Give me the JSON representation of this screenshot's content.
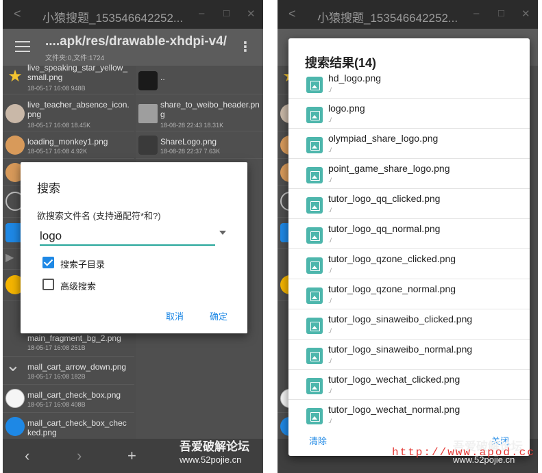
{
  "left": {
    "title": "小猿搜题_153546642252...",
    "path": "....apk/res/drawable-xhdpi-v4/",
    "summary": "文件夹:0,文件:1724",
    "files_left": [
      {
        "name": "live_speaking_star_yellow_small.png",
        "meta": "18-05-17 16:08  948B"
      },
      {
        "name": "live_teacher_absence_icon.png",
        "meta": "18-05-17 16:08  18.45K"
      },
      {
        "name": "loading_monkey1.png",
        "meta": "18-05-17 16:08  4.92K"
      },
      {
        "name": "main_fragment_bg_2.png",
        "meta": "18-05-17 16:08  251B"
      },
      {
        "name": "mall_cart_arrow_down.png",
        "meta": "18-05-17 16:08  182B"
      },
      {
        "name": "mall_cart_check_box.png",
        "meta": "18-05-17 16:08  408B"
      },
      {
        "name": "mall_cart_check_box_checked.png",
        "meta": ""
      }
    ],
    "files_right": [
      {
        "name": "..",
        "meta": ""
      },
      {
        "name": "share_to_weibo_header.png",
        "meta": "18-08-28 22:43  18.31K"
      },
      {
        "name": "ShareLogo.png",
        "meta": "18-08-28 22:37  7.63K"
      }
    ],
    "nav": {
      "back": "‹",
      "forward": "›",
      "add": "+"
    },
    "dialog": {
      "title": "搜索",
      "label": "欲搜索文件名 (支持通配符*和?)",
      "value": "logo",
      "opt_subdir": "搜索子目录",
      "opt_advanced": "高级搜索",
      "cancel": "取消",
      "ok": "确定"
    }
  },
  "right": {
    "title": "小猿搜题_153546642252...",
    "results_title": "搜索结果(14)",
    "results": [
      {
        "name": "hd_logo.png",
        "path": "./"
      },
      {
        "name": "logo.png",
        "path": "./"
      },
      {
        "name": "olympiad_share_logo.png",
        "path": "./"
      },
      {
        "name": "point_game_share_logo.png",
        "path": "./"
      },
      {
        "name": "tutor_logo_qq_clicked.png",
        "path": "./"
      },
      {
        "name": "tutor_logo_qq_normal.png",
        "path": "./"
      },
      {
        "name": "tutor_logo_qzone_clicked.png",
        "path": "./"
      },
      {
        "name": "tutor_logo_qzone_normal.png",
        "path": "./"
      },
      {
        "name": "tutor_logo_sinaweibo_clicked.png",
        "path": "./"
      },
      {
        "name": "tutor_logo_sinaweibo_normal.png",
        "path": "./"
      },
      {
        "name": "tutor_logo_wechat_clicked.png",
        "path": "./"
      },
      {
        "name": "tutor_logo_wechat_normal.png",
        "path": "./"
      }
    ],
    "clear": "清除",
    "close": "关闭"
  },
  "watermark": {
    "left_title": "吾爱破解论坛",
    "left_url": "www.52pojie.cn",
    "right_title": "吾爱破解论坛",
    "right_url": "www.52pojie.cn",
    "site_url": "http://www.apod.cc"
  },
  "colors": {
    "accent": "#1e88e5",
    "teal": "#26a69a",
    "icon_teal": "#4db6ac",
    "url_red": "#e53935"
  },
  "icons": {
    "menu": "menu-icon",
    "more": "more-vert-icon",
    "image": "image-file-icon",
    "checkbox": "checkbox-icon",
    "dropdown": "dropdown-icon"
  }
}
